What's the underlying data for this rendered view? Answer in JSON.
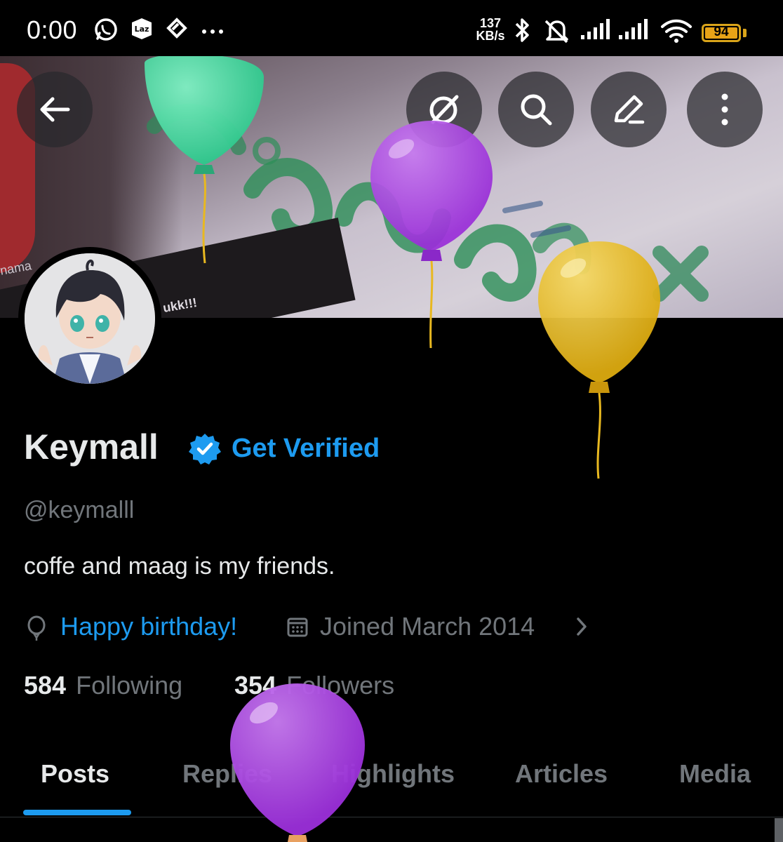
{
  "status_bar": {
    "time": "0:00",
    "net_speed_value": "137",
    "net_speed_unit": "KB/s",
    "battery": "94",
    "battery_color": "#e8a317",
    "icons": [
      "whatsapp-icon",
      "lazada-icon",
      "messaging-app-icon",
      "more-dots-icon",
      "bluetooth-icon",
      "silent-bell-icon",
      "signal-icon",
      "signal-icon",
      "wifi-icon",
      "battery-icon"
    ]
  },
  "header": {
    "buttons": [
      "back-arrow-icon",
      "grok-icon",
      "search-icon",
      "edit-icon",
      "more-vertical-icon"
    ]
  },
  "profile": {
    "name": "Keymall",
    "get_verified": "Get Verified",
    "handle": "@keymalll",
    "bio": "coffe and maag is my friends.",
    "birthday": "Happy birthday!",
    "joined": "Joined March 2014",
    "following_count": "584",
    "following_label": "Following",
    "followers_count": "354",
    "followers_label": "Followers",
    "accent_color": "#1d9bf0"
  },
  "tabs": [
    {
      "label": "Posts",
      "active": true
    },
    {
      "label": "Replies",
      "active": false
    },
    {
      "label": "Highlights",
      "active": false
    },
    {
      "label": "Articles",
      "active": false
    },
    {
      "label": "Media",
      "active": false
    }
  ],
  "banner_text": [
    "nama",
    "ukk!!!"
  ],
  "balloon_colors": [
    "#3fd59c",
    "#a43be0",
    "#e6b718",
    "#a43be0"
  ]
}
